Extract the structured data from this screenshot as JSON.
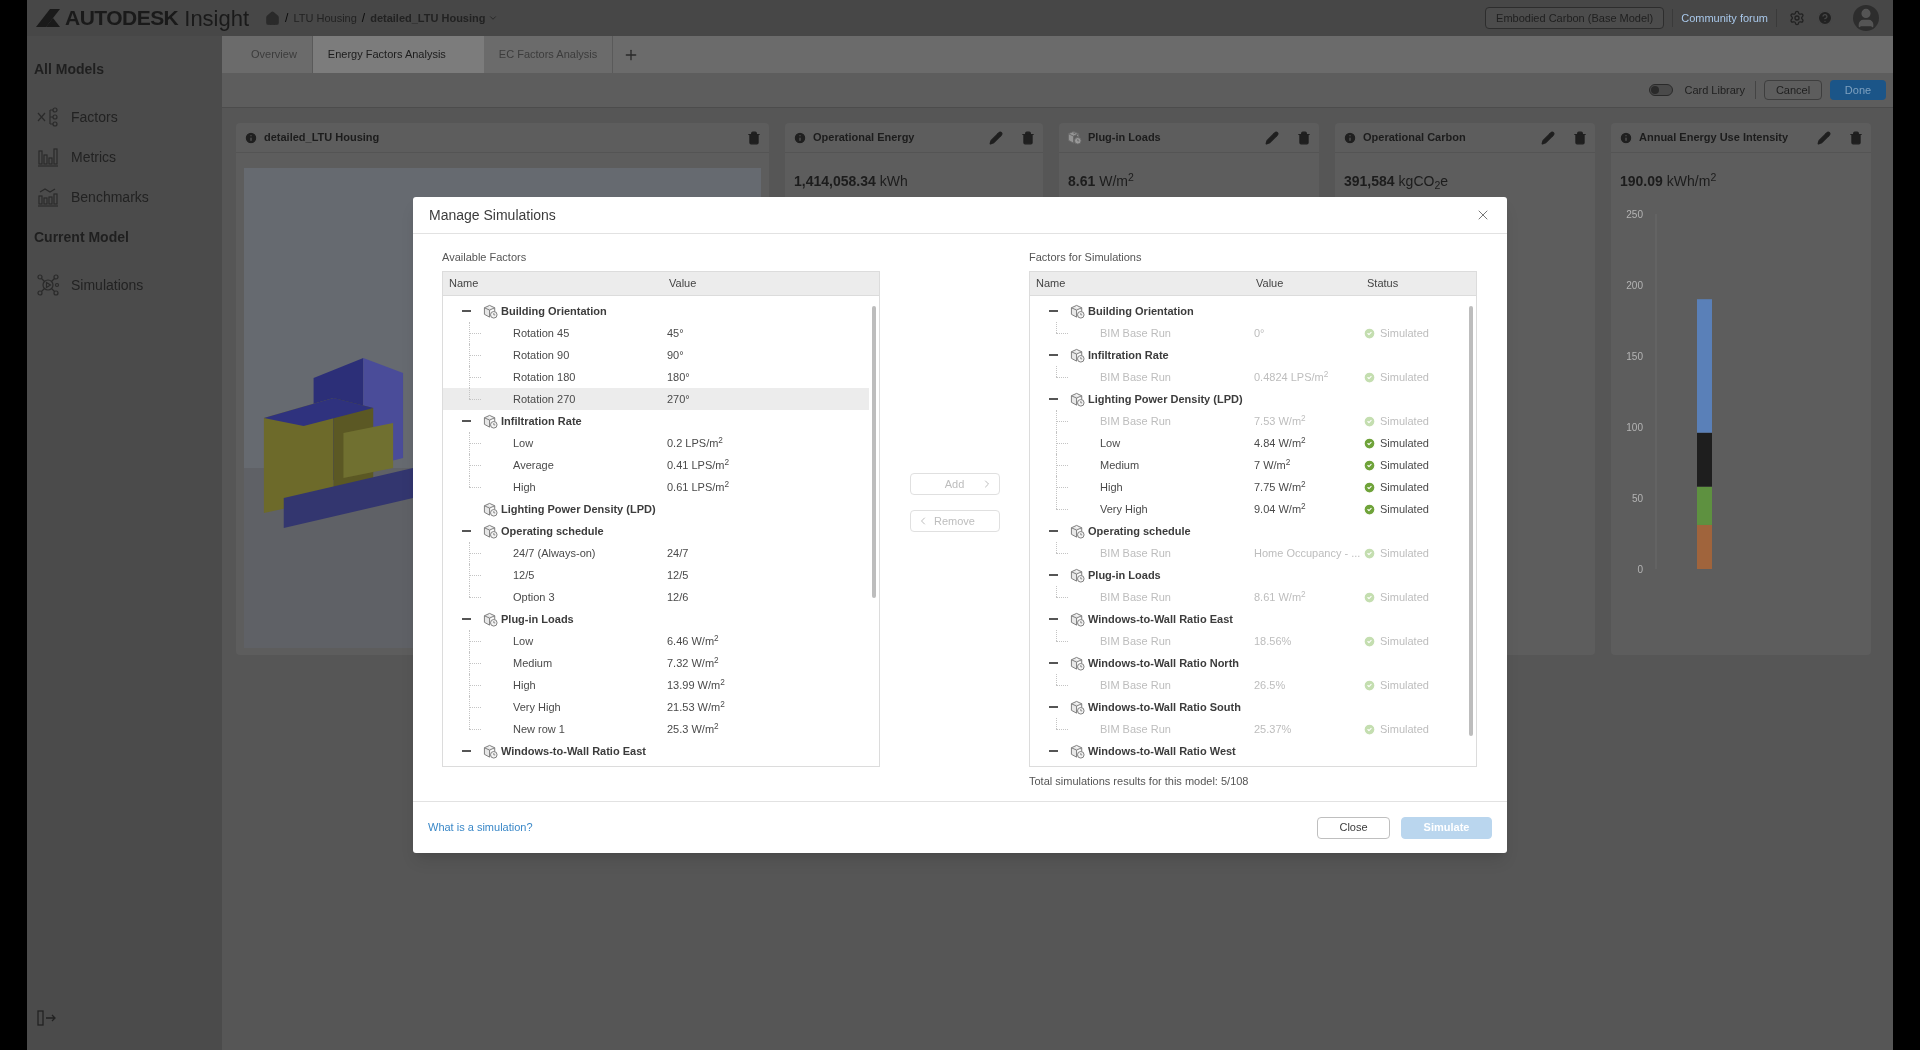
{
  "topbar": {
    "brand": "AUTODESK",
    "product": "Insight",
    "separator": "/",
    "breadcrumb": [
      "LTU Housing",
      "detailed_LTU Housing"
    ],
    "model_button": "Embodied Carbon (Base Model)",
    "forum_link": "Community forum"
  },
  "sidebar": {
    "sections": [
      {
        "title": "All Models",
        "items": [
          {
            "label": "Factors",
            "kind": "factors"
          },
          {
            "label": "Metrics",
            "kind": "metrics"
          },
          {
            "label": "Benchmarks",
            "kind": "benchmarks"
          }
        ]
      },
      {
        "title": "Current Model",
        "items": [
          {
            "label": "Simulations",
            "kind": "simulations"
          }
        ]
      }
    ]
  },
  "tabs": [
    {
      "label": "Overview",
      "selected": false
    },
    {
      "label": "Energy Factors Analysis",
      "selected": true
    },
    {
      "label": "EC Factors Analysis",
      "selected": false
    }
  ],
  "toolbar": {
    "card_library": {
      "label": "Card Library",
      "on": false
    },
    "cancel": "Cancel",
    "done": "Done"
  },
  "cards": [
    {
      "kind": "model",
      "title": "detailed_LTU Housing",
      "editable": false
    },
    {
      "kind": "metric",
      "title": "Operational Energy",
      "editable": true,
      "value": "1,414,058.34",
      "unit": "kWh"
    },
    {
      "kind": "factor",
      "title": "Plug-in Loads",
      "editable": true,
      "value": "8.61",
      "unit": "W/m$^{2}$"
    },
    {
      "kind": "metric",
      "title": "Operational Carbon",
      "editable": true,
      "value": "391,584",
      "unit": "kgCO$_{2}$e"
    },
    {
      "kind": "chart",
      "title": "Annual Energy Use Intensity",
      "editable": true,
      "value": "190.09",
      "unit": "kWh/m$^{2}$",
      "chart_data": {
        "type": "bar",
        "stacked": true,
        "ylim": [
          0,
          250
        ],
        "yticks": [
          0,
          50,
          100,
          150,
          200,
          250
        ],
        "series": [
          {
            "color": "#a0643c",
            "values": [
              31
            ]
          },
          {
            "color": "#5e9140",
            "values": [
              27
            ]
          },
          {
            "color": "#1e1e1e",
            "values": [
              38
            ]
          },
          {
            "color": "#5a80b8",
            "values": [
              94
            ]
          }
        ]
      }
    }
  ],
  "dialog": {
    "title": "Manage Simulations",
    "available": {
      "title": "Available Factors",
      "columns": [
        "Name",
        "Value"
      ],
      "groups": [
        {
          "name": "Building Orientation",
          "expanded": true,
          "children": [
            {
              "name": "Rotation 45",
              "value": "45°",
              "selected": false
            },
            {
              "name": "Rotation 90",
              "value": "90°",
              "selected": false
            },
            {
              "name": "Rotation 180",
              "value": "180°",
              "selected": false
            },
            {
              "name": "Rotation 270",
              "value": "270°",
              "selected": true
            }
          ]
        },
        {
          "name": "Infiltration Rate",
          "expanded": true,
          "children": [
            {
              "name": "Low",
              "value": "0.2 LPS/m$^{2}$",
              "selected": false
            },
            {
              "name": "Average",
              "value": "0.41 LPS/m$^{2}$",
              "selected": false
            },
            {
              "name": "High",
              "value": "0.61 LPS/m$^{2}$",
              "selected": false
            }
          ]
        },
        {
          "name": "Lighting Power Density (LPD)"
        },
        {
          "name": "Operating schedule",
          "expanded": true,
          "children": [
            {
              "name": "24/7 (Always-on)",
              "value": "24/7",
              "selected": false
            },
            {
              "name": "12/5",
              "value": "12/5",
              "selected": false
            },
            {
              "name": "Option 3",
              "value": "12/6",
              "selected": false
            }
          ]
        },
        {
          "name": "Plug-in Loads",
          "expanded": true,
          "children": [
            {
              "name": "Low",
              "value": "6.46 W/m$^{2}$",
              "selected": false
            },
            {
              "name": "Medium",
              "value": "7.32 W/m$^{2}$",
              "selected": false
            },
            {
              "name": "High",
              "value": "13.99 W/m$^{2}$",
              "selected": false
            },
            {
              "name": "Very High",
              "value": "21.53 W/m$^{2}$",
              "selected": false
            },
            {
              "name": "New row 1",
              "value": "25.3 W/m$^{2}$",
              "selected": false
            }
          ]
        },
        {
          "name": "Windows-to-Wall Ratio East",
          "expanded": true
        }
      ]
    },
    "add": {
      "label": "Add",
      "disabled": true
    },
    "remove": {
      "label": "Remove",
      "disabled": true
    },
    "selected_factors": {
      "title": "Factors for Simulations",
      "columns": [
        "Name",
        "Value",
        "Status"
      ],
      "groups": [
        {
          "name": "Building Orientation",
          "expanded": true,
          "children": [
            {
              "name": "BIM Base Run",
              "value": "0°",
              "status": "Simulated",
              "dimmed": true
            }
          ]
        },
        {
          "name": "Infiltration Rate",
          "expanded": true,
          "children": [
            {
              "name": "BIM Base Run",
              "value": "0.4824 LPS/m$^{2}$",
              "status": "Simulated",
              "dimmed": true
            }
          ]
        },
        {
          "name": "Lighting Power Density (LPD)",
          "expanded": true,
          "children": [
            {
              "name": "BIM Base Run",
              "value": "7.53 W/m$^{2}$",
              "status": "Simulated",
              "dimmed": true
            },
            {
              "name": "Low",
              "value": "4.84 W/m$^{2}$",
              "status": "Simulated",
              "dimmed": false
            },
            {
              "name": "Medium",
              "value": "7 W/m$^{2}$",
              "status": "Simulated",
              "dimmed": false
            },
            {
              "name": "High",
              "value": "7.75 W/m$^{2}$",
              "status": "Simulated",
              "dimmed": false
            },
            {
              "name": "Very High",
              "value": "9.04 W/m$^{2}$",
              "status": "Simulated",
              "dimmed": false
            }
          ]
        },
        {
          "name": "Operating schedule",
          "expanded": true,
          "children": [
            {
              "name": "BIM Base Run",
              "value": "Home Occupancy - ...",
              "status": "Simulated",
              "dimmed": true
            }
          ]
        },
        {
          "name": "Plug-in Loads",
          "expanded": true,
          "children": [
            {
              "name": "BIM Base Run",
              "value": "8.61 W/m$^{2}$",
              "status": "Simulated",
              "dimmed": true
            }
          ]
        },
        {
          "name": "Windows-to-Wall Ratio East",
          "expanded": true,
          "children": [
            {
              "name": "BIM Base Run",
              "value": "18.56%",
              "status": "Simulated",
              "dimmed": true
            }
          ]
        },
        {
          "name": "Windows-to-Wall Ratio North",
          "expanded": true,
          "children": [
            {
              "name": "BIM Base Run",
              "value": "26.5%",
              "status": "Simulated",
              "dimmed": true
            }
          ]
        },
        {
          "name": "Windows-to-Wall Ratio South",
          "expanded": true,
          "children": [
            {
              "name": "BIM Base Run",
              "value": "25.37%",
              "status": "Simulated",
              "dimmed": true
            }
          ]
        },
        {
          "name": "Windows-to-Wall Ratio West",
          "expanded": true
        }
      ]
    },
    "total": "Total simulations results for this model: 5/108",
    "help_link": "What is a simulation?",
    "close": {
      "label": "Close",
      "disabled": false
    },
    "simulate": {
      "label": "Simulate",
      "disabled": true
    }
  }
}
